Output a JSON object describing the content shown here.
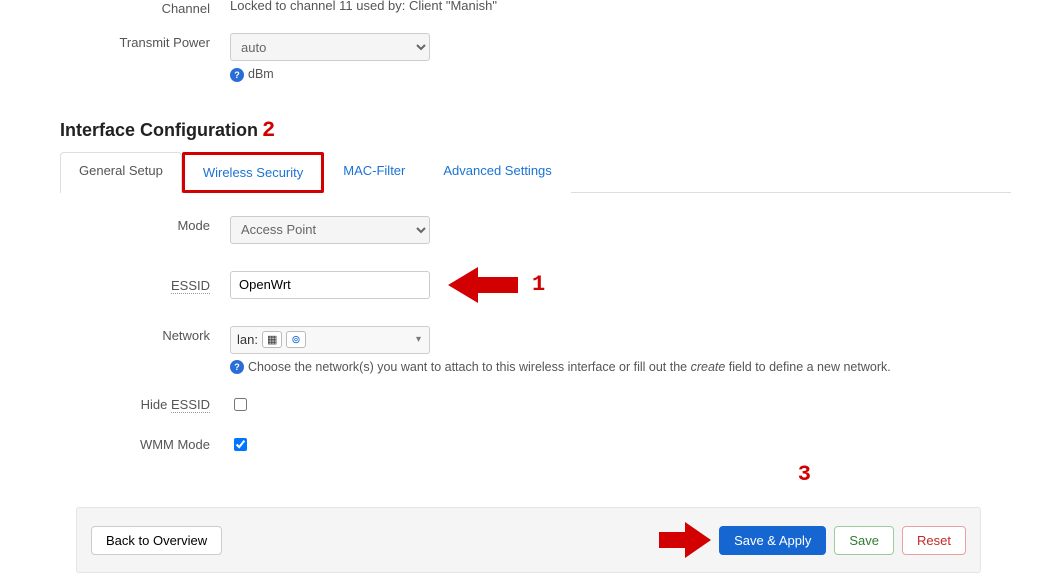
{
  "top": {
    "channel_label": "Channel",
    "channel_value": "Locked to channel 11 used by: Client \"Manish\"",
    "tx_power_label": "Transmit Power",
    "tx_power_value": "auto",
    "tx_power_unit": "dBm"
  },
  "section_title": "Interface Configuration",
  "tabs": {
    "general": "General Setup",
    "security": "Wireless Security",
    "mac": "MAC-Filter",
    "advanced": "Advanced Settings"
  },
  "form": {
    "mode_label": "Mode",
    "mode_value": "Access Point",
    "essid_label": "ESSID",
    "essid_value": "OpenWrt",
    "network_label": "Network",
    "network_value": "lan:",
    "network_hint_pre": "Choose the network(s) you want to attach to this wireless interface or fill out the ",
    "network_hint_em": "create",
    "network_hint_post": " field to define a new network.",
    "hide_label": "Hide ",
    "hide_abbr": "ESSID",
    "wmm_label": "WMM Mode"
  },
  "footer": {
    "back": "Back to Overview",
    "save_apply": "Save & Apply",
    "save": "Save",
    "reset": "Reset"
  },
  "annotations": {
    "n1": "1",
    "n2": "2",
    "n3": "3"
  }
}
